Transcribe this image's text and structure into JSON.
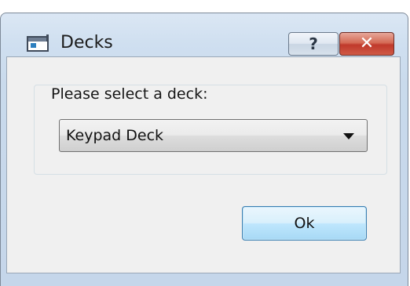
{
  "window": {
    "title": "Decks",
    "icon": "application-window-icon",
    "help_label": "?",
    "close_label": "✕"
  },
  "group": {
    "label": "Please select a deck:"
  },
  "deck_select": {
    "selected_value": "Keypad Deck"
  },
  "buttons": {
    "ok_label": "Ok"
  },
  "colors": {
    "titlebar": "#cfdff0",
    "close_button": "#c0392b",
    "ok_button_focus": "#bee6fd"
  }
}
